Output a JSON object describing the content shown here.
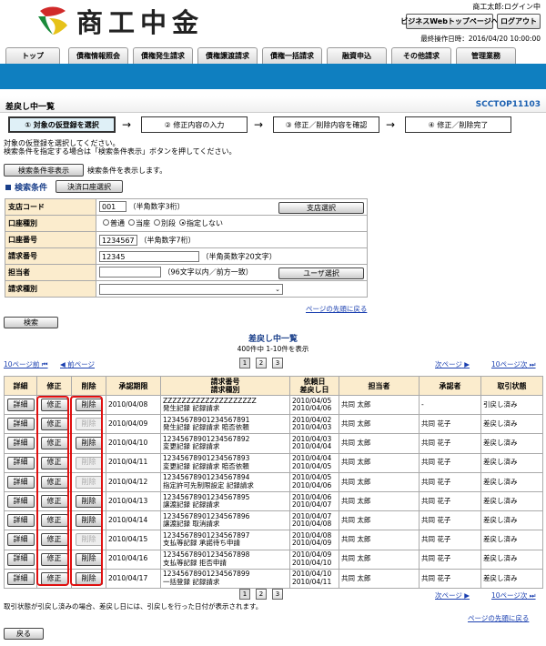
{
  "header": {
    "logo_text": "商工中金",
    "user_status": "商工太郎:ログイン中",
    "top_page_button": "ビジネスWebトップページへ",
    "logout_button": "ログアウト",
    "last_operation": "最終操作日時：2016/04/20 10:00:00"
  },
  "nav": {
    "tabs": [
      "トップ",
      "債権情報照会",
      "債権発生請求",
      "債権譲渡請求",
      "債権一括請求",
      "融資申込",
      "その他請求",
      "管理業務"
    ]
  },
  "page": {
    "title": "差戻し中一覧",
    "screen_id": "SCCTOP11103"
  },
  "steps": [
    "① 対象の仮登録を選択",
    "② 修正内容の入力",
    "③ 修正／削除内容を確認",
    "④ 修正／削除完了"
  ],
  "instructions": [
    "対象の仮登録を選択してください。",
    "検索条件を指定する場合は「検索条件表示」ボタンを押してください。"
  ],
  "search_toggle": {
    "button": "検索条件非表示",
    "note": "検索条件を表示します。"
  },
  "search": {
    "heading": "検索条件",
    "account_select_button": "決済口座選択",
    "branch_code_label": "支店コード",
    "branch_code_value": "001",
    "branch_code_hint": "（半角数字3桁）",
    "branch_select_button": "支店選択",
    "account_type_label": "口座種別",
    "account_type_options": [
      "普通",
      "当座",
      "別段",
      "指定しない"
    ],
    "account_type_selected": 3,
    "account_number_label": "口座番号",
    "account_number_value": "1234567",
    "account_number_hint": "（半角数字7桁）",
    "request_number_label": "請求番号",
    "request_number_value": "12345",
    "request_number_hint": "（半角英数字20文字）",
    "person_label": "担当者",
    "person_value": "",
    "person_hint": "（96文字以内／前方一致）",
    "user_select_button": "ユーザ選択",
    "request_type_label": "請求種別",
    "request_type_value": "",
    "page_top_link": "ページの先頭に戻る",
    "search_button": "検索"
  },
  "results": {
    "title": "差戻し中一覧",
    "count_text": "400件中 1-10件を表示",
    "prev10": "10ページ前",
    "prev": "前ページ",
    "next": "次ページ",
    "next10": "10ページ次",
    "pages": [
      "1",
      "2",
      "3"
    ],
    "columns": {
      "detail": "詳細",
      "edit": "修正",
      "delete": "削除",
      "approval_deadline": "承認期限",
      "request_no": "請求番号",
      "request_type": "請求種別",
      "request_date": "依頼日",
      "return_date": "差戻し日",
      "person": "担当者",
      "approver": "承認者",
      "cancel_status": "取引状態"
    },
    "button_labels": {
      "detail": "詳細",
      "edit": "修正",
      "delete": "削除"
    },
    "rows": [
      {
        "deadline": "2010/04/08",
        "req_no": "ZZZZZZZZZZZZZZZZZZZZ",
        "req_type": "発生記録 記録請求",
        "req_date": "2010/04/05",
        "ret_date": "2010/04/06",
        "person": "共同 太郎",
        "approver": "-",
        "status": "引戻し済み",
        "delete_enabled": true
      },
      {
        "deadline": "2010/04/09",
        "req_no": "12345678901234567891",
        "req_type": "発生記録 記録請求 賠否依頼",
        "req_date": "2010/04/02",
        "ret_date": "2010/04/03",
        "person": "共同 太郎",
        "approver": "共同 花子",
        "status": "差戻し済み",
        "delete_enabled": false
      },
      {
        "deadline": "2010/04/10",
        "req_no": "12345678901234567892",
        "req_type": "変更記録 記録請求",
        "req_date": "2010/04/03",
        "ret_date": "2010/04/04",
        "person": "共同 太郎",
        "approver": "共同 花子",
        "status": "差戻し済み",
        "delete_enabled": true
      },
      {
        "deadline": "2010/04/11",
        "req_no": "12345678901234567893",
        "req_type": "変更記録 記録請求 賠否依頼",
        "req_date": "2010/04/04",
        "ret_date": "2010/04/05",
        "person": "共同 太郎",
        "approver": "共同 花子",
        "status": "差戻し済み",
        "delete_enabled": false
      },
      {
        "deadline": "2010/04/12",
        "req_no": "12345678901234567894",
        "req_type": "指定許可先制限設定 記録請求",
        "req_date": "2010/04/05",
        "ret_date": "2010/04/06",
        "person": "共同 太郎",
        "approver": "共同 花子",
        "status": "差戻し済み",
        "delete_enabled": false
      },
      {
        "deadline": "2010/04/13",
        "req_no": "12345678901234567895",
        "req_type": "譲渡記録 記録請求",
        "req_date": "2010/04/06",
        "ret_date": "2010/04/07",
        "person": "共同 太郎",
        "approver": "共同 花子",
        "status": "差戻し済み",
        "delete_enabled": true
      },
      {
        "deadline": "2010/04/14",
        "req_no": "12345678901234567896",
        "req_type": "譲渡記録 取消請求",
        "req_date": "2010/04/07",
        "ret_date": "2010/04/08",
        "person": "共同 太郎",
        "approver": "共同 花子",
        "status": "差戻し済み",
        "delete_enabled": true
      },
      {
        "deadline": "2010/04/15",
        "req_no": "12345678901234567897",
        "req_type": "支払等記録 承諾待ち申請",
        "req_date": "2010/04/08",
        "ret_date": "2010/04/09",
        "person": "共同 太郎",
        "approver": "共同 花子",
        "status": "差戻し済み",
        "delete_enabled": false
      },
      {
        "deadline": "2010/04/16",
        "req_no": "12345678901234567898",
        "req_type": "支払等記録 拒否申請",
        "req_date": "2010/04/09",
        "ret_date": "2010/04/10",
        "person": "共同 太郎",
        "approver": "共同 花子",
        "status": "差戻し済み",
        "delete_enabled": true
      },
      {
        "deadline": "2010/04/17",
        "req_no": "12345678901234567899",
        "req_type": "一括登録 記録請求",
        "req_date": "2010/04/10",
        "ret_date": "2010/04/11",
        "person": "共同 太郎",
        "approver": "共同 花子",
        "status": "差戻し済み",
        "delete_enabled": true
      }
    ],
    "footnote": "取引状態が引戻し済みの場合、差戻し日には、引戻しを行った日付が表示されます。",
    "page_top_link": "ページの先頭に戻る"
  },
  "back_button": "戻る",
  "colors": {
    "band": "#0f7fc0",
    "label_bg": "#fbeccd",
    "highlight": "#e01010",
    "link": "#1a3fb0",
    "screen_id": "#1a5fb0"
  }
}
